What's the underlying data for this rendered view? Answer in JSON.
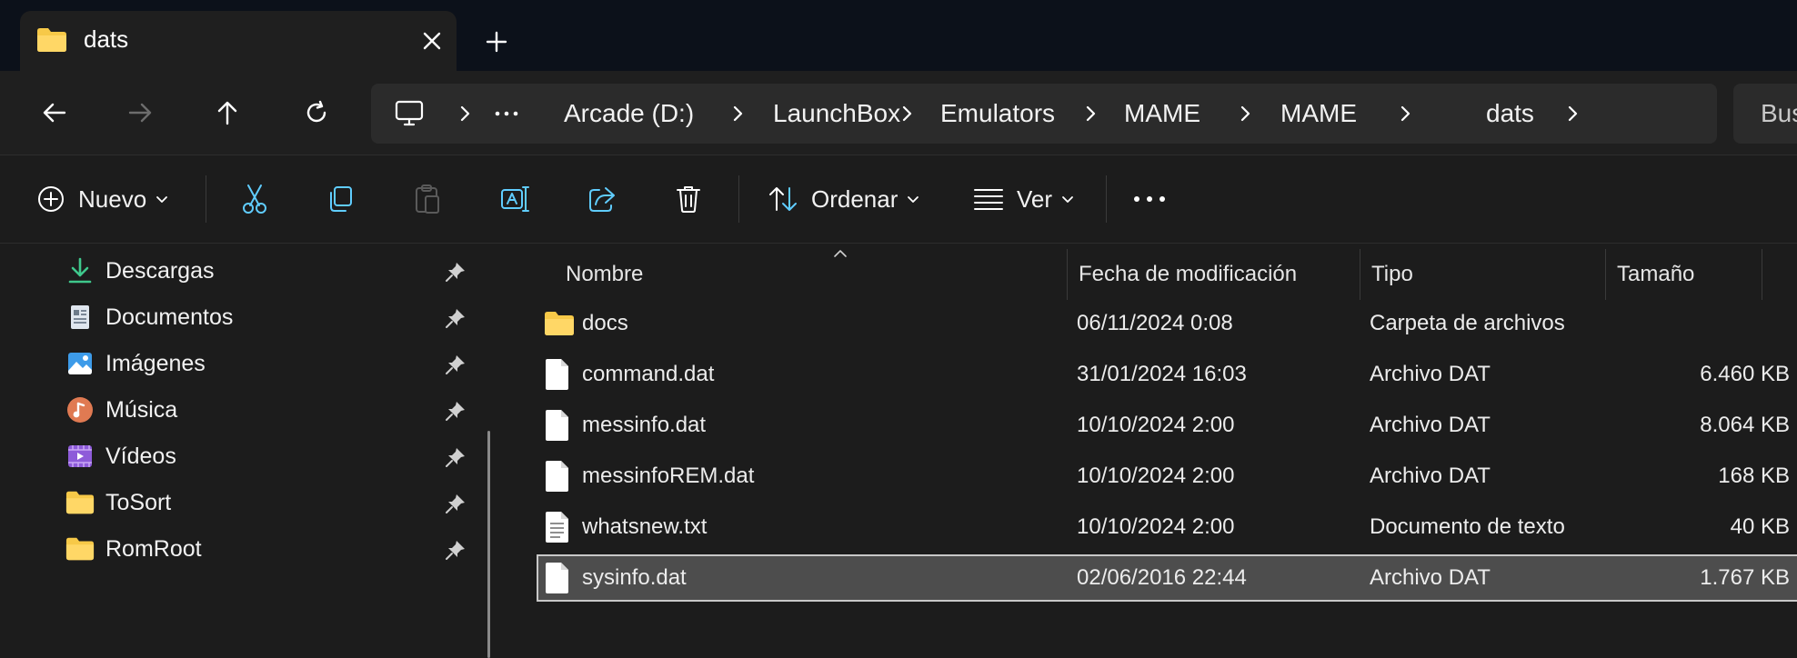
{
  "tab": {
    "title": "dats"
  },
  "breadcrumbs": [
    "Arcade (D:)",
    "LaunchBox",
    "Emulators",
    "MAME",
    "MAME",
    "dats"
  ],
  "search": {
    "placeholder": "Bus"
  },
  "toolbar": {
    "new_label": "Nuevo",
    "sort_label": "Ordenar",
    "view_label": "Ver"
  },
  "sidebar": {
    "items": [
      {
        "label": "Descargas",
        "icon": "download-icon"
      },
      {
        "label": "Documentos",
        "icon": "documents-icon"
      },
      {
        "label": "Imágenes",
        "icon": "pictures-icon"
      },
      {
        "label": "Música",
        "icon": "music-icon"
      },
      {
        "label": "Vídeos",
        "icon": "videos-icon"
      },
      {
        "label": "ToSort",
        "icon": "folder-icon"
      },
      {
        "label": "RomRoot",
        "icon": "folder-icon"
      }
    ]
  },
  "columns": {
    "name": "Nombre",
    "modified": "Fecha de modificación",
    "type": "Tipo",
    "size": "Tamaño"
  },
  "files": [
    {
      "name": "docs",
      "modified": "06/11/2024 0:08",
      "type": "Carpeta de archivos",
      "size": "",
      "icon": "folder-icon"
    },
    {
      "name": "command.dat",
      "modified": "31/01/2024 16:03",
      "type": "Archivo DAT",
      "size": "6.460 KB",
      "icon": "file-icon"
    },
    {
      "name": "messinfo.dat",
      "modified": "10/10/2024 2:00",
      "type": "Archivo DAT",
      "size": "8.064 KB",
      "icon": "file-icon"
    },
    {
      "name": "messinfoREM.dat",
      "modified": "10/10/2024 2:00",
      "type": "Archivo DAT",
      "size": "168 KB",
      "icon": "file-icon"
    },
    {
      "name": "whatsnew.txt",
      "modified": "10/10/2024 2:00",
      "type": "Documento de texto",
      "size": "40 KB",
      "icon": "text-file-icon"
    },
    {
      "name": "sysinfo.dat",
      "modified": "02/06/2016 22:44",
      "type": "Archivo DAT",
      "size": "1.767 KB",
      "icon": "file-icon",
      "selected": true
    }
  ],
  "colors": {
    "accent": "#60cdff",
    "folder": "#f7c948",
    "background": "#1c1c1c"
  }
}
